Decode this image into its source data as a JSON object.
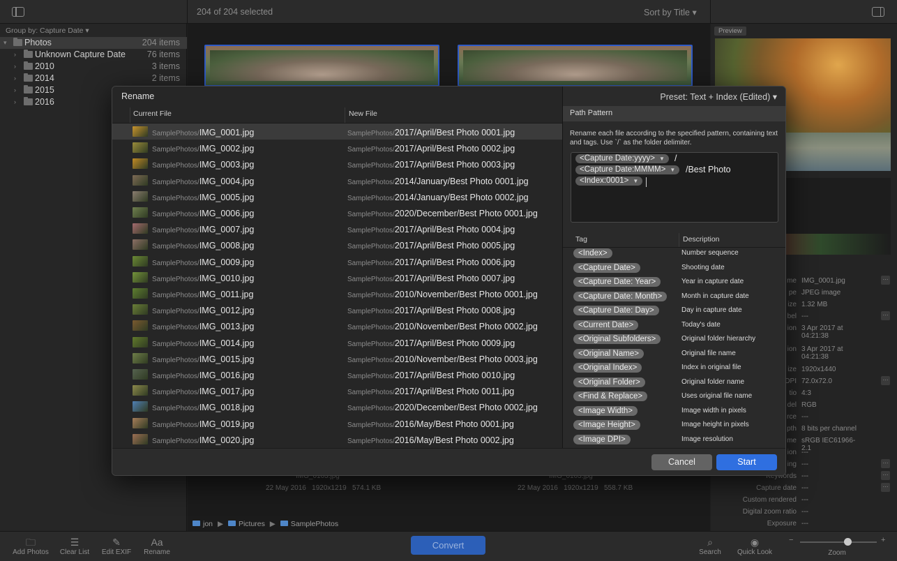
{
  "topbar": {
    "selection_count": "204 of 204 selected",
    "sort_label": "Sort by Title ▾"
  },
  "sidebar": {
    "group_by": "Group by: Capture Date ▾",
    "items": [
      {
        "label": "Photos",
        "count": "204 items"
      },
      {
        "label": "Unknown Capture Date",
        "count": "76 items"
      },
      {
        "label": "2010",
        "count": "3 items"
      },
      {
        "label": "2014",
        "count": "2 items"
      },
      {
        "label": "2015",
        "count": ""
      },
      {
        "label": "2016",
        "count": ""
      }
    ]
  },
  "main": {
    "thumbs": [
      {
        "caption": "IMG_0103.jpg",
        "meta": "22 May 2016   1920x1219   574.1 KB"
      },
      {
        "caption": "IMG_0103.jpg",
        "meta": "22 May 2016   1920x1219   558.7 KB"
      }
    ],
    "breadcrumb": [
      "jon",
      "Pictures",
      "SamplePhotos"
    ]
  },
  "right_panel": {
    "preview_label": "Preview",
    "info": [
      {
        "label": "me",
        "value": "IMG_0001.jpg"
      },
      {
        "label": "pe",
        "value": "JPEG image"
      },
      {
        "label": "ize",
        "value": "1.32 MB"
      },
      {
        "label": "bel",
        "value": "---"
      },
      {
        "label": "ion",
        "value": "3 Apr 2017 at 04:21:38"
      },
      {
        "label": "ion",
        "value": "3 Apr 2017 at 04:21:38"
      },
      {
        "label": "ize",
        "value": "1920x1440"
      },
      {
        "label": "DPI",
        "value": "72.0x72.0"
      },
      {
        "label": "tio",
        "value": "4:3"
      },
      {
        "label": "del",
        "value": "RGB"
      },
      {
        "label": "rce",
        "value": "---"
      },
      {
        "label": "pth",
        "value": "8 bits per channel"
      },
      {
        "label": "me",
        "value": "sRGB IEC61966-2.1"
      },
      {
        "label": "ion",
        "value": "---"
      },
      {
        "label": "ing",
        "value": "---"
      },
      {
        "label": "Keywords",
        "value": "---"
      },
      {
        "label": "Capture date",
        "value": "---"
      },
      {
        "label": "Custom rendered",
        "value": "---"
      },
      {
        "label": "Digital zoom ratio",
        "value": "---"
      },
      {
        "label": "Exposure",
        "value": "---"
      }
    ]
  },
  "toolbar": {
    "add_photos": "Add Photos",
    "clear_list": "Clear List",
    "edit_exif": "Edit EXIF",
    "rename": "Rename",
    "convert": "Convert",
    "search": "Search",
    "quick_look": "Quick Look",
    "zoom": "Zoom",
    "zoom_minus": "−",
    "zoom_plus": "+"
  },
  "dialog": {
    "title": "Rename",
    "current_header": "Current File",
    "new_header": "New File",
    "prefix_current": "SamplePhotos/",
    "prefix_new": "SamplePhotos/",
    "files": [
      {
        "cur": "IMG_0001.jpg",
        "new": "2017/April/Best Photo 0001.jpg",
        "c": "#c8942e"
      },
      {
        "cur": "IMG_0002.jpg",
        "new": "2017/April/Best Photo 0002.jpg",
        "c": "#9a8c3a"
      },
      {
        "cur": "IMG_0003.jpg",
        "new": "2017/April/Best Photo 0003.jpg",
        "c": "#c08a25"
      },
      {
        "cur": "IMG_0004.jpg",
        "new": "2014/January/Best Photo 0001.jpg",
        "c": "#7d6a55"
      },
      {
        "cur": "IMG_0005.jpg",
        "new": "2014/January/Best Photo 0002.jpg",
        "c": "#8a7d70"
      },
      {
        "cur": "IMG_0006.jpg",
        "new": "2020/December/Best Photo 0001.jpg",
        "c": "#6f7f4f"
      },
      {
        "cur": "IMG_0007.jpg",
        "new": "2017/April/Best Photo 0004.jpg",
        "c": "#a46a6e"
      },
      {
        "cur": "IMG_0008.jpg",
        "new": "2017/April/Best Photo 0005.jpg",
        "c": "#8c6f66"
      },
      {
        "cur": "IMG_0009.jpg",
        "new": "2017/April/Best Photo 0006.jpg",
        "c": "#6b8a35"
      },
      {
        "cur": "IMG_0010.jpg",
        "new": "2017/April/Best Photo 0007.jpg",
        "c": "#74943a"
      },
      {
        "cur": "IMG_0011.jpg",
        "new": "2010/November/Best Photo 0001.jpg",
        "c": "#5e7f30"
      },
      {
        "cur": "IMG_0012.jpg",
        "new": "2017/April/Best Photo 0008.jpg",
        "c": "#6a7e38"
      },
      {
        "cur": "IMG_0013.jpg",
        "new": "2010/November/Best Photo 0002.jpg",
        "c": "#7a5a30"
      },
      {
        "cur": "IMG_0014.jpg",
        "new": "2017/April/Best Photo 0009.jpg",
        "c": "#617a2c"
      },
      {
        "cur": "IMG_0015.jpg",
        "new": "2010/November/Best Photo 0003.jpg",
        "c": "#6e7e48"
      },
      {
        "cur": "IMG_0016.jpg",
        "new": "2017/April/Best Photo 0010.jpg",
        "c": "#55624f"
      },
      {
        "cur": "IMG_0017.jpg",
        "new": "2017/April/Best Photo 0011.jpg",
        "c": "#8d8a4c"
      },
      {
        "cur": "IMG_0018.jpg",
        "new": "2020/December/Best Photo 0002.jpg",
        "c": "#4f7fb4"
      },
      {
        "cur": "IMG_0019.jpg",
        "new": "2016/May/Best Photo 0001.jpg",
        "c": "#a67d5a"
      },
      {
        "cur": "IMG_0020.jpg",
        "new": "2016/May/Best Photo 0002.jpg",
        "c": "#9c6f54"
      }
    ],
    "preset": "Preset: Text + Index (Edited) ▾",
    "path_pattern_header": "Path Pattern",
    "path_pattern_desc": "Rename each file according to the specified pattern, containing text and tags. Use `/` as the folder delimiter.",
    "pattern": {
      "token1": "<Capture Date:yyyy>",
      "sep1": "/",
      "token2": "<Capture Date:MMMM>",
      "sep2": "/Best Photo",
      "token3": "<Index:0001>"
    },
    "tag_header": "Tag",
    "desc_header": "Description",
    "tags": [
      {
        "tag": "<Index>",
        "desc": "Number sequence"
      },
      {
        "tag": "<Capture Date>",
        "desc": "Shooting date"
      },
      {
        "tag": "<Capture Date: Year>",
        "desc": "Year in capture date"
      },
      {
        "tag": "<Capture Date: Month>",
        "desc": "Month in capture date"
      },
      {
        "tag": "<Capture Date: Day>",
        "desc": "Day in capture date"
      },
      {
        "tag": "<Current Date>",
        "desc": "Today's date"
      },
      {
        "tag": "<Original Subfolders>",
        "desc": "Original folder hierarchy"
      },
      {
        "tag": "<Original Name>",
        "desc": "Original file name"
      },
      {
        "tag": "<Original Index>",
        "desc": "Index in original file"
      },
      {
        "tag": "<Original Folder>",
        "desc": "Original folder name"
      },
      {
        "tag": "<Find & Replace>",
        "desc": "Uses original file name"
      },
      {
        "tag": "<Image Width>",
        "desc": "Image width in pixels"
      },
      {
        "tag": "<Image Height>",
        "desc": "Image height in pixels"
      },
      {
        "tag": "<Image DPI>",
        "desc": "Image resolution"
      }
    ],
    "cancel": "Cancel",
    "start": "Start"
  }
}
